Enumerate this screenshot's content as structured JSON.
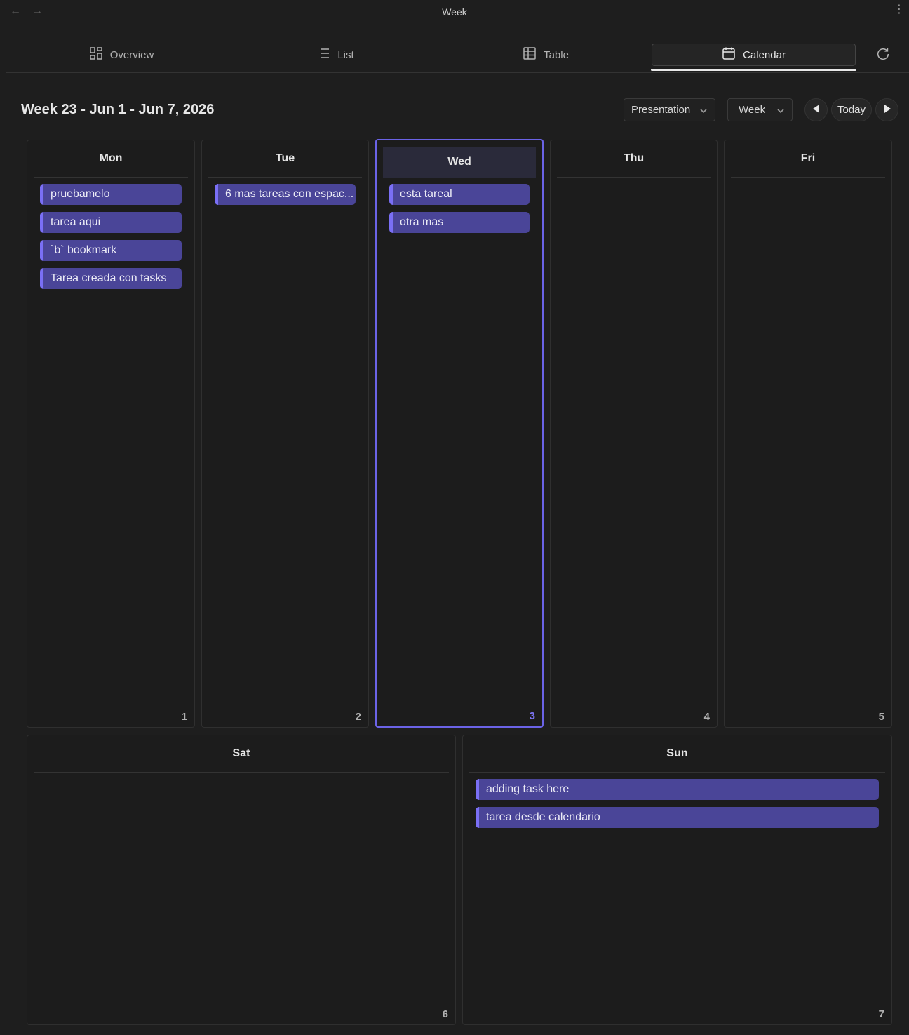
{
  "window": {
    "title": "Week",
    "back_icon": "arrow-left-icon",
    "forward_icon": "arrow-right-icon",
    "more_icon": "more-vertical-icon"
  },
  "tabs": [
    {
      "label": "Overview",
      "icon": "grid-icon"
    },
    {
      "label": "List",
      "icon": "list-icon"
    },
    {
      "label": "Table",
      "icon": "table-icon"
    },
    {
      "label": "Calendar",
      "icon": "calendar-icon",
      "active": true
    }
  ],
  "toolbar": {
    "week_title": "Week 23 - Jun 1 - Jun 7, 2026",
    "presentation": "Presentation",
    "view": "Week",
    "today": "Today"
  },
  "days": [
    {
      "name": "Mon",
      "number": "1",
      "tasks": [
        "pruebamelo",
        "tarea aqui",
        "`b` bookmark",
        "Tarea creada con tasks"
      ]
    },
    {
      "name": "Tue",
      "number": "2",
      "tasks": [
        "6 mas tareas con espac..."
      ]
    },
    {
      "name": "Wed",
      "number": "3",
      "today": true,
      "tasks": [
        "esta tareal",
        "otra mas"
      ]
    },
    {
      "name": "Thu",
      "number": "4",
      "tasks": []
    },
    {
      "name": "Fri",
      "number": "5",
      "tasks": []
    },
    {
      "name": "Sat",
      "number": "6",
      "tasks": []
    },
    {
      "name": "Sun",
      "number": "7",
      "tasks": [
        "adding task here",
        "tarea desde calendario"
      ]
    }
  ],
  "colors": {
    "accent": "#6b63e6",
    "task_bg": "#4a4598",
    "task_border": "#7a6ff5",
    "background": "#1e1e1e"
  }
}
